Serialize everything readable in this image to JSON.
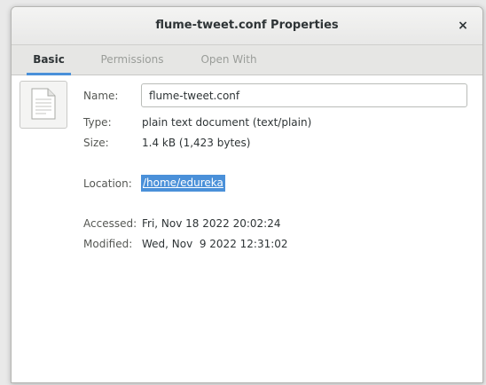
{
  "window": {
    "title": "flume-tweet.conf Properties",
    "close_symbol": "×"
  },
  "tabs": [
    {
      "label": "Basic",
      "active": true
    },
    {
      "label": "Permissions",
      "active": false
    },
    {
      "label": "Open With",
      "active": false
    }
  ],
  "basic": {
    "icon": "text-document-icon",
    "name_label": "Name:",
    "name_value": "flume-tweet.conf",
    "type_label": "Type:",
    "type_value": "plain text document (text/plain)",
    "size_label": "Size:",
    "size_value": "1.4 kB (1,423 bytes)",
    "location_label": "Location:",
    "location_value": "/home/edureka",
    "accessed_label": "Accessed:",
    "accessed_value": "Fri, Nov 18 2022 20:02:24",
    "modified_label": "Modified:",
    "modified_value": "Wed, Nov  9 2022 12:31:02"
  },
  "colors": {
    "accent": "#4a90d9",
    "text": "#2e3436",
    "dim_text": "#9a9d99"
  }
}
